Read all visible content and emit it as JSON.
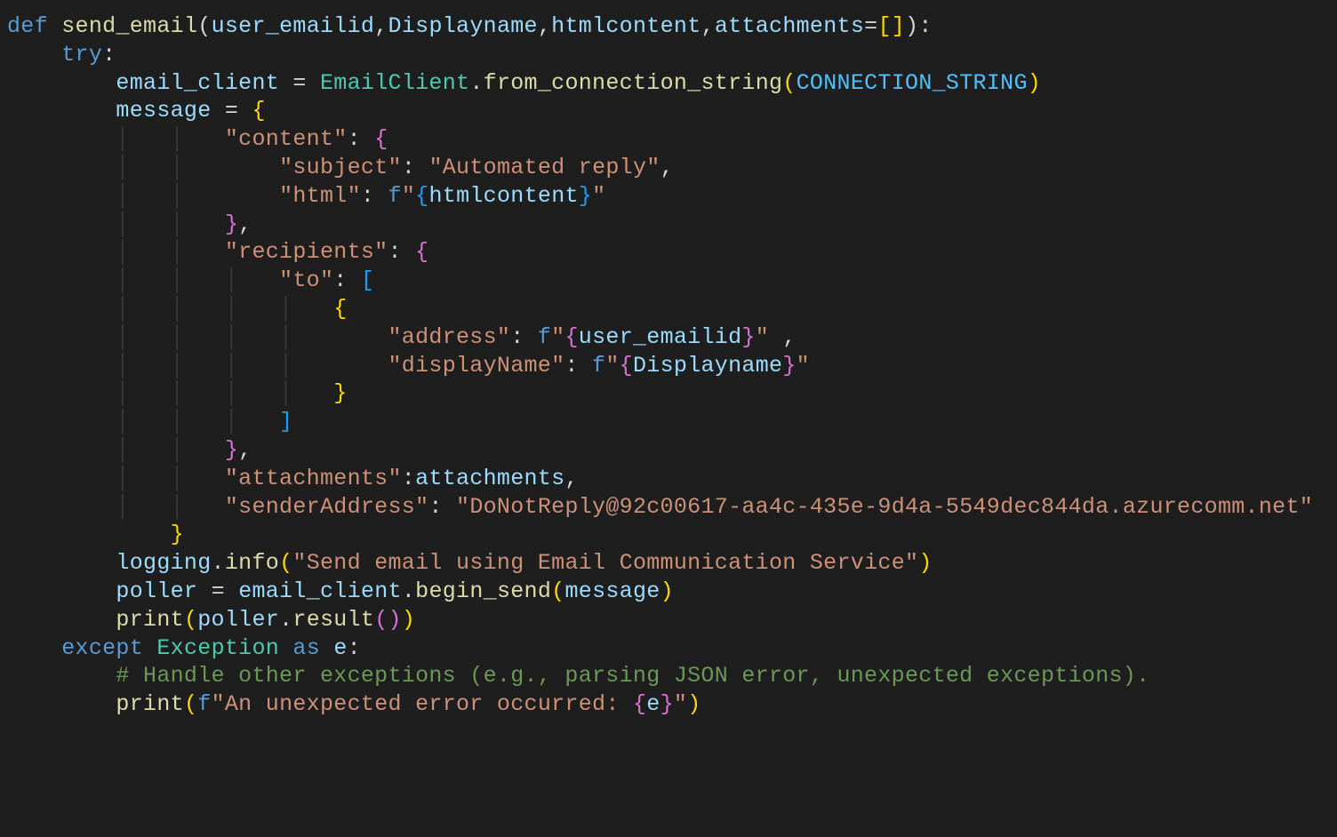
{
  "code": {
    "l1": {
      "kw": "def",
      "fn": "send_email",
      "p1": "user_emailid",
      "p2": "Displayname",
      "p3": "htmlcontent",
      "p4": "attachments"
    },
    "l2": {
      "kw": "try"
    },
    "l3": {
      "v": "email_client",
      "cls": "EmailClient",
      "m": "from_connection_string",
      "c": "CONNECTION_STRING"
    },
    "l4": {
      "v": "message"
    },
    "l5": {
      "k": "\"content\""
    },
    "l6": {
      "k": "\"subject\"",
      "val": "\"Automated reply\""
    },
    "l7": {
      "k": "\"html\"",
      "var": "htmlcontent"
    },
    "l9": {
      "k": "\"recipients\""
    },
    "l10": {
      "k": "\"to\""
    },
    "l12": {
      "k": "\"address\"",
      "var": "user_emailid"
    },
    "l13": {
      "k": "\"displayName\"",
      "var": "Displayname"
    },
    "l17": {
      "k": "\"attachments\"",
      "var": "attachments"
    },
    "l18": {
      "k": "\"senderAddress\"",
      "val": "\"DoNotReply@92c00617-aa4c-435e-9d4a-5549dec844da.azurecomm.net\""
    },
    "l20": {
      "mod": "logging",
      "fn": "info",
      "val": "\"Send email using Email Communication Service\""
    },
    "l21": {
      "v": "poller",
      "obj": "email_client",
      "fn": "begin_send",
      "arg": "message"
    },
    "l22": {
      "fn": "print",
      "obj": "poller",
      "m": "result"
    },
    "l23": {
      "kw1": "except",
      "cls": "Exception",
      "kw2": "as",
      "v": "e"
    },
    "l24": {
      "c": "# Handle other exceptions (e.g., parsing JSON error, unexpected exceptions)."
    },
    "l25": {
      "fn": "print",
      "s1": "\"An unexpected error occurred: ",
      "var": "e",
      "s2": "\""
    }
  }
}
